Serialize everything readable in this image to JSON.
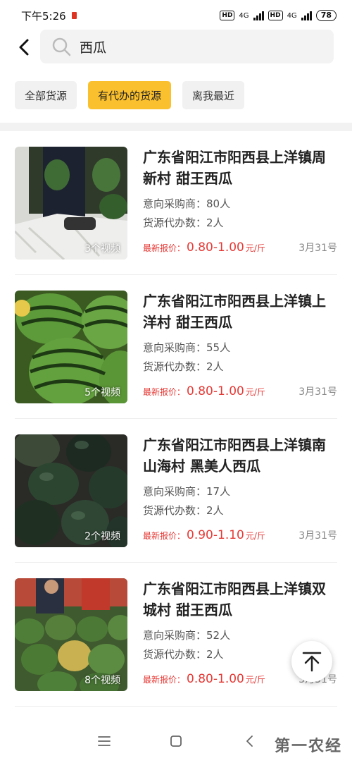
{
  "status_bar": {
    "time": "下午5:26",
    "net1": "4G",
    "net2": "4G",
    "hd": "HD",
    "battery": "78"
  },
  "search": {
    "query": "西瓜"
  },
  "filters": [
    {
      "label": "全部货源",
      "active": false
    },
    {
      "label": "有代办的货源",
      "active": true
    },
    {
      "label": "离我最近",
      "active": false
    }
  ],
  "listings": [
    {
      "title": "广东省阳江市阳西县上洋镇周新村 甜王西瓜",
      "video_count": "3个视频",
      "buyers": "意向采购商：80人",
      "agents": "货源代办数：2人",
      "price_label": "最新报价：",
      "price": "0.80-1.00",
      "price_unit": "元/斤",
      "date": "3月31号",
      "thumb_scene": "sacks"
    },
    {
      "title": "广东省阳江市阳西县上洋镇上洋村 甜王西瓜",
      "video_count": "5个视频",
      "buyers": "意向采购商：55人",
      "agents": "货源代办数：2人",
      "price_label": "最新报价：",
      "price": "0.80-1.00",
      "price_unit": "元/斤",
      "date": "3月31号",
      "thumb_scene": "striped"
    },
    {
      "title": "广东省阳江市阳西县上洋镇南山海村 黑美人西瓜",
      "video_count": "2个视频",
      "buyers": "意向采购商：17人",
      "agents": "货源代办数：2人",
      "price_label": "最新报价：",
      "price": "0.90-1.10",
      "price_unit": "元/斤",
      "date": "3月31号",
      "thumb_scene": "dark"
    },
    {
      "title": "广东省阳江市阳西县上洋镇双城村 甜王西瓜",
      "video_count": "8个视频",
      "buyers": "意向采购商：52人",
      "agents": "货源代办数：2人",
      "price_label": "最新报价：",
      "price": "0.80-1.00",
      "price_unit": "元/斤",
      "date": "3月31号",
      "thumb_scene": "market"
    }
  ],
  "watermark": "第一农经",
  "colors": {
    "accent": "#fbc02d",
    "price": "#e53935"
  },
  "icons": {
    "back": "chevron-left-icon",
    "search": "search-icon",
    "fab": "arrow-to-top-icon",
    "nav_menu": "menu-icon",
    "nav_home": "home-square-icon",
    "nav_back": "back-triangle-icon"
  }
}
